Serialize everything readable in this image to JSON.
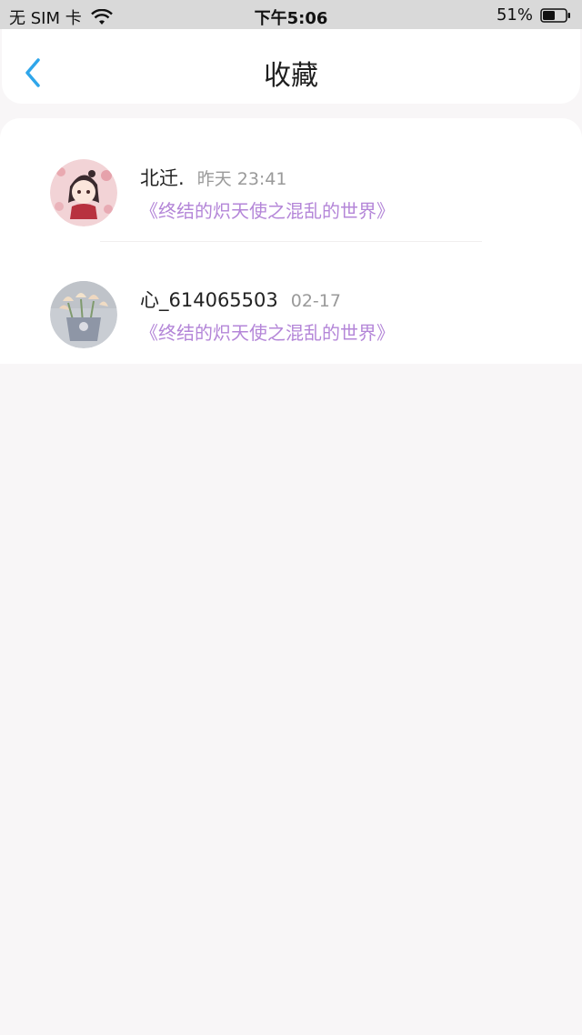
{
  "status_bar": {
    "carrier": "无 SIM 卡",
    "time": "下午5:06",
    "battery": "51%"
  },
  "header": {
    "title": "收藏"
  },
  "favorites": [
    {
      "name": "北迁.",
      "time": "昨天 23:41",
      "work": "《终结的炽天使之混乱的世界》"
    },
    {
      "name": "心_614065503",
      "time": "02-17",
      "work": "《终结的炽天使之混乱的世界》"
    }
  ],
  "colors": {
    "accent": "#2fa6ea",
    "link": "#b486d8",
    "status_bar_bg": "#d9d9d9",
    "page_bg": "#f8f6f7"
  }
}
